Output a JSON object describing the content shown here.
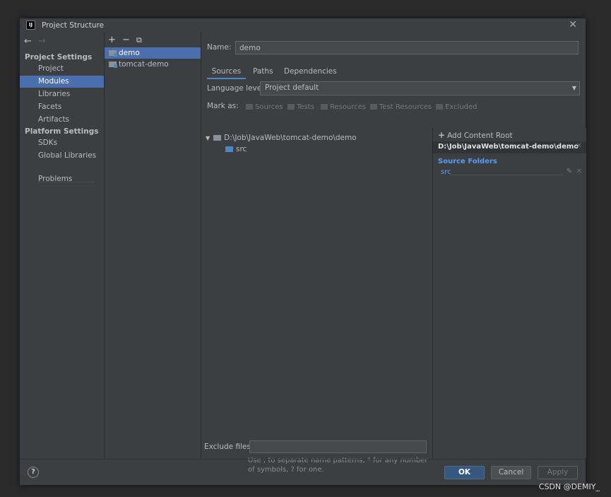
{
  "window": {
    "title": "Project Structure",
    "close_glyph": "✕",
    "app_icon_text": "IJ"
  },
  "nav": {
    "back": "←",
    "forward": "→"
  },
  "sidebar": {
    "project_settings_header": "Project Settings",
    "project_items": [
      "Project",
      "Modules",
      "Libraries",
      "Facets",
      "Artifacts"
    ],
    "platform_settings_header": "Platform Settings",
    "platform_items": [
      "SDKs",
      "Global Libraries"
    ],
    "problems": "Problems"
  },
  "modules_toolbar": {
    "add": "+",
    "remove": "−",
    "copy": "⧉"
  },
  "modules": [
    "demo",
    "tomcat-demo"
  ],
  "main": {
    "name_label": "Name:",
    "name_value": "demo",
    "tabs": [
      "Sources",
      "Paths",
      "Dependencies"
    ],
    "language_level_label": "Language level:",
    "language_level_value": "Project default",
    "mark_as_label": "Mark as:",
    "mark_buttons": [
      "Sources",
      "Tests",
      "Resources",
      "Test Resources",
      "Excluded"
    ],
    "tree_root": "D:\\Job\\JavaWeb\\tomcat-demo\\demo",
    "tree_child": "src",
    "exclude_label": "Exclude files:",
    "exclude_value": "",
    "hint": "Use ; to separate name patterns, * for any number of symbols, ? for one."
  },
  "right_panel": {
    "add_content_root": "Add Content Root",
    "root_path": "D:\\Job\\JavaWeb\\tomcat-demo\\demo",
    "source_folders_header": "Source Folders",
    "source_folder": "src"
  },
  "footer": {
    "help": "?",
    "ok": "OK",
    "cancel": "Cancel",
    "apply": "Apply"
  },
  "watermark": "CSDN @DEMIY_",
  "colors": {
    "selection": "#4b6eaf",
    "accent_blue": "#4a88c7",
    "source_folder_blue": "#589df6"
  }
}
